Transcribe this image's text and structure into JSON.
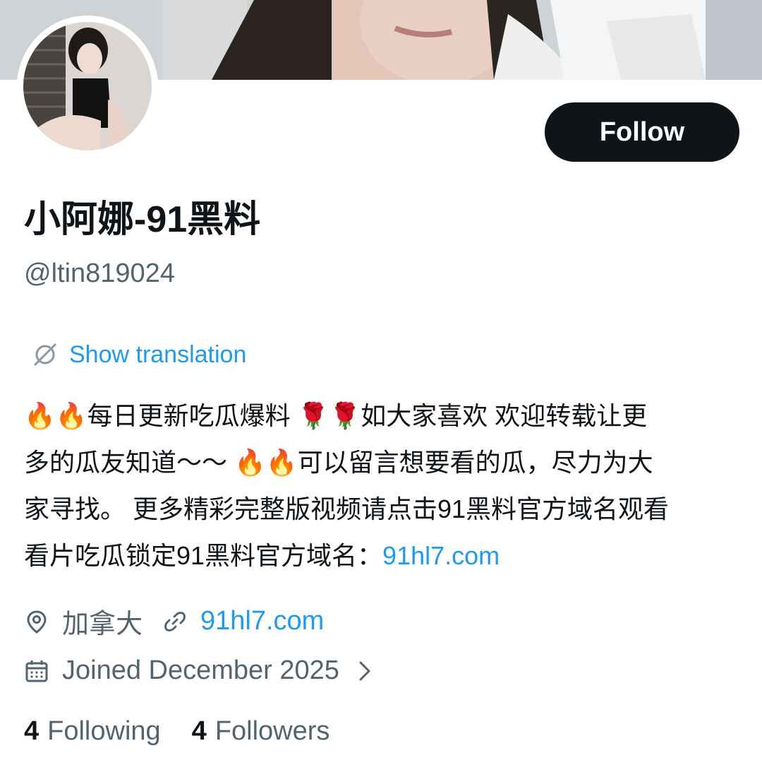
{
  "profile": {
    "display_name": "小阿娜-91黑料",
    "handle": "@ltin819024",
    "follow_label": "Follow"
  },
  "translation": {
    "label": "Show translation",
    "icon": "translate-icon"
  },
  "bio": {
    "line1": "🔥🔥每日更新吃瓜爆料 🌹🌹如大家喜欢 欢迎转载让更",
    "line2": "多的瓜友知道～～ 🔥🔥可以留言想要看的瓜，尽力为大",
    "line3": "家寻找。 更多精彩完整版视频请点击91黑料官方域名观看",
    "line4_text": "看片吃瓜锁定91黑料官方域名：",
    "line4_link": "91hl7.com"
  },
  "meta": {
    "location": "加拿大",
    "location_icon": "location-pin-icon",
    "website": "91hl7.com",
    "website_icon": "link-icon",
    "joined": "Joined December 2025",
    "joined_icon": "calendar-icon"
  },
  "stats": {
    "following_count": "4",
    "following_label": "Following",
    "followers_count": "4",
    "followers_label": "Followers"
  },
  "colors": {
    "accent": "#1d9bf0",
    "text_primary": "#0f1419",
    "text_secondary": "#536471",
    "button_bg": "#0f1419"
  }
}
